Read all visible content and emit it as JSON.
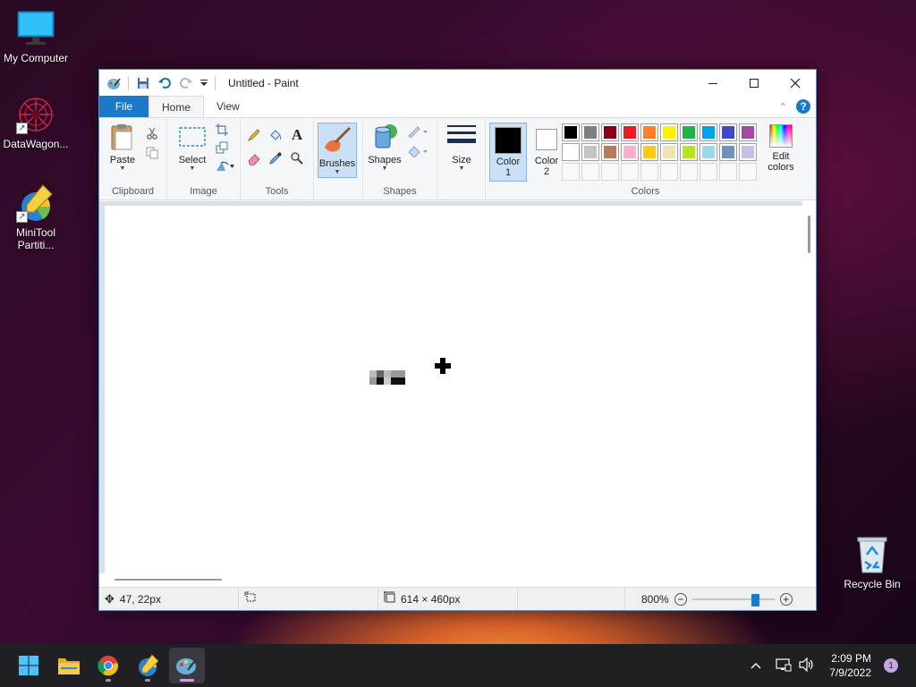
{
  "desktop": {
    "icons": [
      {
        "label": "My Computer"
      },
      {
        "label": "DataWagon..."
      },
      {
        "label": "MiniTool Partiti..."
      },
      {
        "label": "Recycle Bin"
      }
    ]
  },
  "window": {
    "title": "Untitled - Paint"
  },
  "tabs": {
    "file": "File",
    "home": "Home",
    "view": "View"
  },
  "ribbon": {
    "clipboard": {
      "label": "Clipboard",
      "paste": "Paste"
    },
    "image": {
      "label": "Image",
      "select": "Select"
    },
    "tools": {
      "label": "Tools"
    },
    "brushes": {
      "label": "Brushes"
    },
    "shapes": {
      "label": "Shapes",
      "shapes_btn": "Shapes"
    },
    "size": {
      "label": "Size"
    },
    "colors": {
      "label": "Colors",
      "color1": "Color 1",
      "color2": "Color 2",
      "edit_colors": "Edit colors",
      "color1_value": "#000000",
      "color2_value": "#ffffff",
      "palette_row1": [
        "#000000",
        "#7f7f7f",
        "#880015",
        "#ed1c24",
        "#ff7f27",
        "#fff200",
        "#22b14c",
        "#00a2e8",
        "#3f48cc",
        "#a349a4"
      ],
      "palette_row2": [
        "#ffffff",
        "#c3c3c3",
        "#b97a57",
        "#ffaec9",
        "#ffc90e",
        "#efe4b0",
        "#b5e61d",
        "#99d9ea",
        "#7092be",
        "#c8bfe7"
      ]
    }
  },
  "status": {
    "cursor_pos": "47, 22px",
    "image_size": "614 × 460px",
    "zoom": "800%",
    "zoom_level": 0.8
  },
  "taskbar": {
    "time": "2:09 PM",
    "date": "7/9/2022",
    "notifications": "1"
  }
}
